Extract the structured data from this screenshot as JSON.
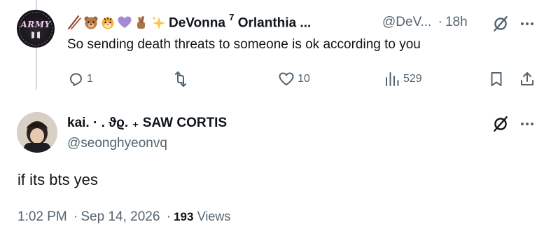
{
  "parent_tweet": {
    "emojis": [
      "🥢",
      "🐻",
      "🐯",
      "💜",
      "🤞",
      "✨"
    ],
    "display_name": "DeVonna",
    "name_superscript": "7",
    "name_suffix": "Orlanthia ...",
    "handle": "@DeV...",
    "separator": "·",
    "time": "18h",
    "text": "So sending death threats to someone is ok according to you",
    "avatar_text": "ARMY",
    "stats": {
      "replies": "1",
      "reposts": "",
      "likes": "10",
      "views": "529"
    }
  },
  "reply_tweet": {
    "display_name": "kai. · . ϑϱ. ₊ SAW CORTIS",
    "handle": "@seonghyeonvq",
    "text": "if its bts yes",
    "time": "1:02 PM",
    "date": "Sep 14, 2026",
    "separator": "·",
    "views_count": "193",
    "views_label": "Views"
  },
  "icons": {
    "reply": "reply-icon",
    "repost": "repost-icon",
    "like": "heart-icon",
    "views": "analytics-icon",
    "bookmark": "bookmark-icon",
    "share": "share-icon",
    "grok": "grok-icon",
    "more": "more-icon"
  },
  "colors": {
    "text_primary": "#0f1419",
    "text_secondary": "#536471",
    "thread_line": "#cfd9de",
    "emoji_purple_heart": "#a48ad4",
    "emoji_sparkle": "#f6c64a"
  }
}
